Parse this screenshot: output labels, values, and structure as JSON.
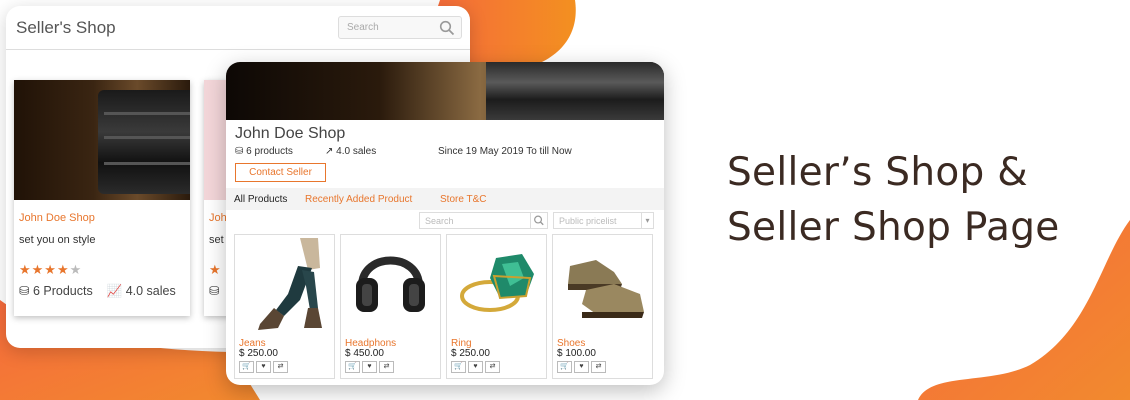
{
  "colors": {
    "accent": "#e8762d",
    "brand_gradient_start": "#f56a3c",
    "brand_gradient_end": "#f39020",
    "headline": "#3b2a22"
  },
  "back_card": {
    "title": "Seller's Shop",
    "search": {
      "placeholder": "Search",
      "icon": "search-icon"
    },
    "product": {
      "name": "John Doe Shop",
      "tagline": "set you on style",
      "rating": {
        "value": 4,
        "max": 5
      },
      "products_label": "6 Products",
      "sales_label": "4.0 sales"
    },
    "product2": {
      "name": "Joh",
      "tagline": "set"
    }
  },
  "front_card": {
    "shop_name": "John Doe Shop",
    "products_count": "6 products",
    "sales": "4.0 sales",
    "since": "Since 19 May 2019 To till Now",
    "contact_button": "Contact Seller",
    "tabs": [
      "All Products",
      "Recently Added Product",
      "Store T&C"
    ],
    "search_placeholder": "Search",
    "pricelist_placeholder": "Public pricelist",
    "products": [
      {
        "name": "Jeans",
        "price": "$ 250.00",
        "image": "jeans-image"
      },
      {
        "name": "Headphons",
        "price": "$ 450.00",
        "image": "headphones-image"
      },
      {
        "name": "Ring",
        "price": "$ 250.00",
        "image": "ring-image"
      },
      {
        "name": "Shoes",
        "price": "$ 100.00",
        "image": "shoes-image"
      }
    ],
    "tile_actions": [
      "cart-icon",
      "heart-icon",
      "compare-icon"
    ]
  },
  "headline": {
    "line1": "Seller’s Shop &",
    "line2": "Seller Shop Page"
  }
}
